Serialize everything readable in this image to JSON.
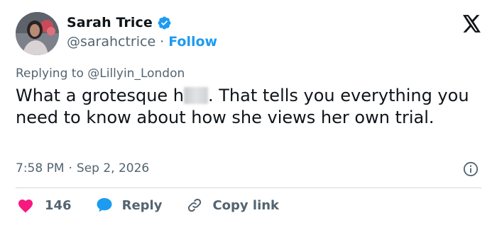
{
  "author": {
    "name": "Sarah Trice",
    "handle": "@sarahctrice",
    "separator": "·",
    "follow_label": "Follow"
  },
  "reply_context": {
    "prefix": "Replying to",
    "mention": "@Lillyin_London"
  },
  "tweet": {
    "text_before_redaction": "What a grotesque h",
    "text_after_redaction": ". That tells you everything you need to know about how she views her own trial."
  },
  "meta": {
    "time": "7:58 PM",
    "separator": "·",
    "date": "Sep 2, 2026"
  },
  "actions": {
    "like_count": "146",
    "reply_label": "Reply",
    "copy_label": "Copy link"
  },
  "colors": {
    "accent": "#1d9bf0",
    "like": "#f91880",
    "muted": "#536471",
    "text": "#0f1419"
  },
  "icons": {
    "verified": "verified-badge-icon",
    "brand": "x-logo-icon",
    "info": "info-icon",
    "like": "heart-icon",
    "reply": "speech-bubble-icon",
    "copy": "link-icon"
  }
}
